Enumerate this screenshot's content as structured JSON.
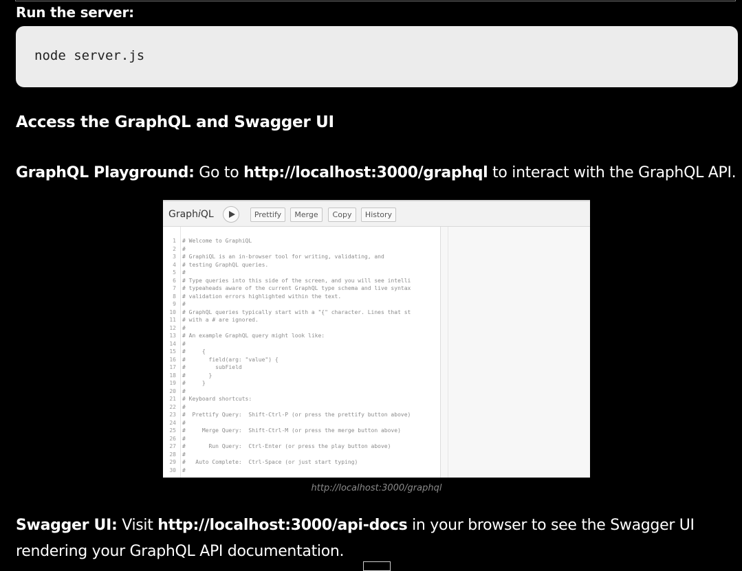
{
  "run_label": "Run the server:",
  "code": "node server.js",
  "heading": "Access the GraphQL and Swagger UI",
  "graphql_para": {
    "label": "GraphQL Playground:",
    "pre": " Go to ",
    "url": "http://localhost:3000/graphql",
    "post": " to interact with the GraphQL API."
  },
  "graphiql": {
    "title_a": "Graph",
    "title_i": "i",
    "title_b": "QL",
    "buttons": [
      "Prettify",
      "Merge",
      "Copy",
      "History"
    ],
    "lines": [
      "# Welcome to GraphiQL",
      "#",
      "# GraphiQL is an in-browser tool for writing, validating, and",
      "# testing GraphQL queries.",
      "#",
      "# Type queries into this side of the screen, and you will see intelli",
      "# typeaheads aware of the current GraphQL type schema and live syntax",
      "# validation errors highlighted within the text.",
      "#",
      "# GraphQL queries typically start with a \"{\" character. Lines that st",
      "# with a # are ignored.",
      "#",
      "# An example GraphQL query might look like:",
      "#",
      "#     {",
      "#       field(arg: \"value\") {",
      "#         subField",
      "#       }",
      "#     }",
      "#",
      "# Keyboard shortcuts:",
      "#",
      "#  Prettify Query:  Shift-Ctrl-P (or press the prettify button above)",
      "#",
      "#     Merge Query:  Shift-Ctrl-M (or press the merge button above)",
      "#",
      "#       Run Query:  Ctrl-Enter (or press the play button above)",
      "#",
      "#   Auto Complete:  Ctrl-Space (or just start typing)",
      "#"
    ]
  },
  "caption": "http://localhost:3000/graphql",
  "swagger_para": {
    "label": "Swagger UI:",
    "pre": " Visit ",
    "url": "http://localhost:3000/api-docs",
    "post": " in your browser to see the Swagger UI",
    "line2": "rendering your GraphQL API documentation."
  }
}
